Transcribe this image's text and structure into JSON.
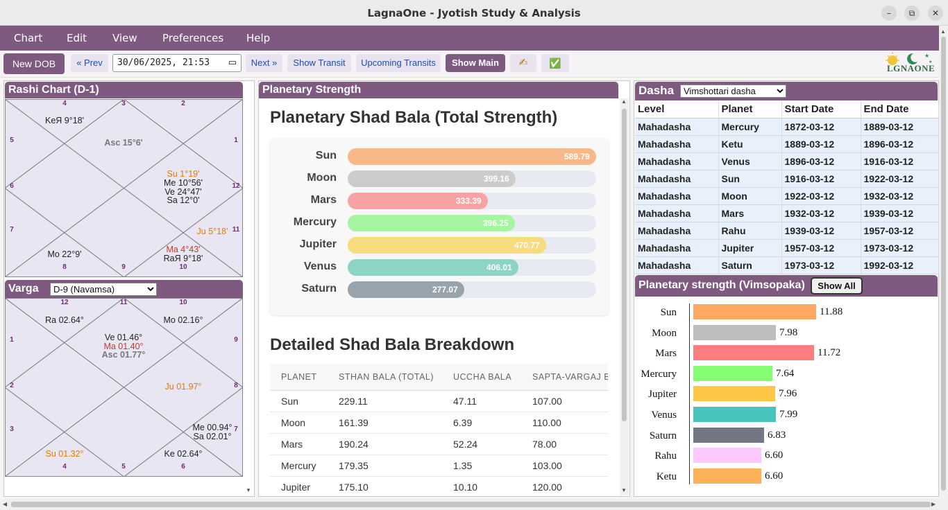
{
  "window": {
    "title": "LagnaOne - Jyotish Study & Analysis",
    "minimize": "–",
    "maximize": "⧉",
    "close": "✕"
  },
  "menu": [
    "Chart",
    "Edit",
    "View",
    "Preferences",
    "Help"
  ],
  "toolbar": {
    "new_dob": "New DOB",
    "prev": "« Prev",
    "datetime": "30/06/2025, 21:53",
    "next": "Next »",
    "show_transit": "Show Transit",
    "upcoming_transits": "Upcoming Transits",
    "show_main": "Show Main",
    "write_icon": "✍",
    "check_icon": "✅",
    "logo_text": "LGNAONE"
  },
  "rashi": {
    "title": "Rashi Chart (D-1)",
    "houses": [
      "4",
      "3",
      "2",
      "5",
      "1",
      "6",
      "12",
      "7",
      "11",
      "8",
      "9",
      "10"
    ],
    "placements": [
      "KeЯ 9°18'",
      "Asc 15°6'",
      "Su 1°19'",
      "Me 10°56'",
      "Ve 24°47'",
      "Sa 12°0'",
      "Ju 5°18'",
      "Mo 22°9'",
      "Ma 4°43'",
      "RaЯ 9°18'"
    ]
  },
  "varga": {
    "title": "Varga",
    "selected": "D-9 (Navamsa)",
    "houses": [
      "12",
      "11",
      "10",
      "1",
      "9",
      "2",
      "8",
      "3",
      "7",
      "4",
      "5",
      "6"
    ],
    "placements": [
      "Ra 02.64°",
      "Ve 01.46°",
      "Ma 01.40°",
      "Asc 01.77°",
      "Mo 02.16°",
      "Ju 01.97°",
      "Me 00.94°",
      "Sa 02.01°",
      "Su 01.32°",
      "Ke 02.64°"
    ]
  },
  "strength": {
    "title": "Planetary Strength",
    "heading": "Planetary Shad Bala (Total Strength)",
    "bars": [
      {
        "planet": "Sun",
        "value": "589.79",
        "pct": 100,
        "color": "#f8b98a"
      },
      {
        "planet": "Moon",
        "value": "399.16",
        "pct": 67.7,
        "color": "#cccccc"
      },
      {
        "planet": "Mars",
        "value": "333.39",
        "pct": 56.5,
        "color": "#f8a3a3"
      },
      {
        "planet": "Mercury",
        "value": "396.25",
        "pct": 67.2,
        "color": "#a6f5a0"
      },
      {
        "planet": "Jupiter",
        "value": "470.77",
        "pct": 79.8,
        "color": "#f6dc7c"
      },
      {
        "planet": "Venus",
        "value": "406.01",
        "pct": 68.8,
        "color": "#8dd3c6"
      },
      {
        "planet": "Saturn",
        "value": "277.07",
        "pct": 47.0,
        "color": "#98a4ab"
      }
    ],
    "breakdown_heading": "Detailed Shad Bala Breakdown",
    "breakdown_columns": [
      "PLANET",
      "STHAN BALA (TOTAL)",
      "UCCHA BALA",
      "SAPTA-VARGAJ B"
    ],
    "breakdown_rows": [
      [
        "Sun",
        "229.11",
        "47.11",
        "107.00"
      ],
      [
        "Moon",
        "161.39",
        "6.39",
        "110.00"
      ],
      [
        "Mars",
        "190.24",
        "52.24",
        "78.00"
      ],
      [
        "Mercury",
        "179.35",
        "1.35",
        "103.00"
      ],
      [
        "Jupiter",
        "175.10",
        "10.10",
        "120.00"
      ]
    ]
  },
  "dasha": {
    "title": "Dasha",
    "selected": "Vimshottari dasha",
    "columns": [
      "Level",
      "Planet",
      "Start Date",
      "End Date"
    ],
    "rows": [
      [
        "Mahadasha",
        "Mercury",
        "1872-03-12",
        "1889-03-12"
      ],
      [
        "Mahadasha",
        "Ketu",
        "1889-03-12",
        "1896-03-12"
      ],
      [
        "Mahadasha",
        "Venus",
        "1896-03-12",
        "1916-03-12"
      ],
      [
        "Mahadasha",
        "Sun",
        "1916-03-12",
        "1922-03-12"
      ],
      [
        "Mahadasha",
        "Moon",
        "1922-03-12",
        "1932-03-12"
      ],
      [
        "Mahadasha",
        "Mars",
        "1932-03-12",
        "1939-03-12"
      ],
      [
        "Mahadasha",
        "Rahu",
        "1939-03-12",
        "1957-03-12"
      ],
      [
        "Mahadasha",
        "Jupiter",
        "1957-03-12",
        "1973-03-12"
      ],
      [
        "Mahadasha",
        "Saturn",
        "1973-03-12",
        "1992-03-12"
      ]
    ]
  },
  "vimsopaka": {
    "title": "Planetary strength (Vimsopaka)",
    "show_all": "Show All",
    "rows": [
      {
        "planet": "Sun",
        "value": "11.88",
        "color": "#fca863"
      },
      {
        "planet": "Moon",
        "value": "7.98",
        "color": "#bdbdbd"
      },
      {
        "planet": "Mars",
        "value": "11.72",
        "color": "#fc7d7d"
      },
      {
        "planet": "Mercury",
        "value": "7.64",
        "color": "#84fc74"
      },
      {
        "planet": "Jupiter",
        "value": "7.96",
        "color": "#fdc745"
      },
      {
        "planet": "Venus",
        "value": "7.99",
        "color": "#49c4bc"
      },
      {
        "planet": "Saturn",
        "value": "6.83",
        "color": "#737784"
      },
      {
        "planet": "Rahu",
        "value": "6.60",
        "color": "#fcc7fc"
      },
      {
        "planet": "Ketu",
        "value": "6.60",
        "color": "#fdb158"
      }
    ]
  }
}
